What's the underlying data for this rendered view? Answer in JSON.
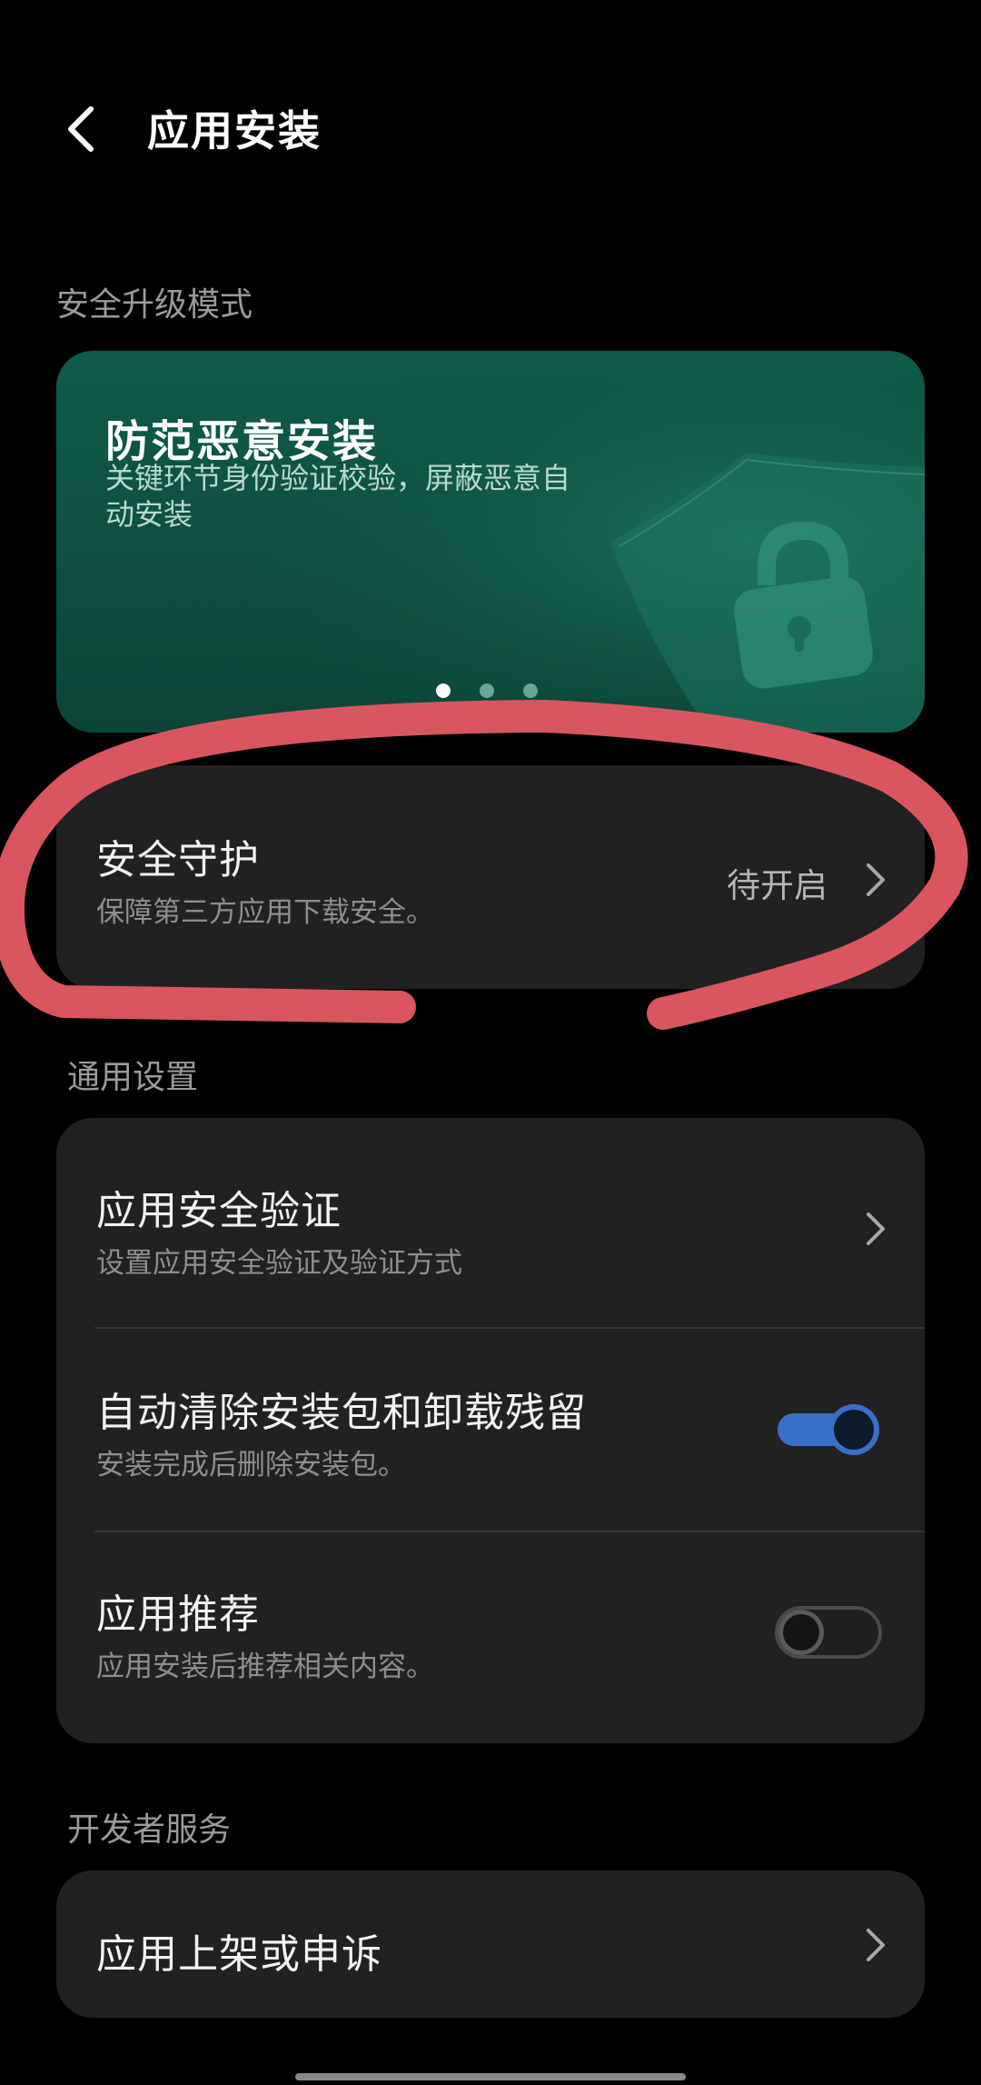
{
  "header": {
    "title": "应用安装"
  },
  "security_section": {
    "label": "安全升级模式",
    "banner": {
      "title": "防范恶意安装",
      "description": "关键环节身份验证校验，屏蔽恶意自动安装",
      "pages": 3,
      "active_page": 1
    },
    "protection": {
      "title": "安全守护",
      "subtitle": "保障第三方应用下载安全。",
      "status": "待开启"
    }
  },
  "general_section": {
    "label": "通用设置",
    "items": [
      {
        "title": "应用安全验证",
        "subtitle": "设置应用安全验证及验证方式"
      },
      {
        "title": "自动清除安装包和卸载残留",
        "subtitle": "安装完成后删除安装包。",
        "enabled": true
      },
      {
        "title": "应用推荐",
        "subtitle": "应用安装后推荐相关内容。",
        "enabled": false
      }
    ]
  },
  "developer_section": {
    "label": "开发者服务",
    "item": {
      "title": "应用上架或申诉"
    }
  },
  "colors": {
    "accent": "#3a6fc8",
    "annotation": "#d9565f",
    "banner": "#0f5b4a"
  }
}
